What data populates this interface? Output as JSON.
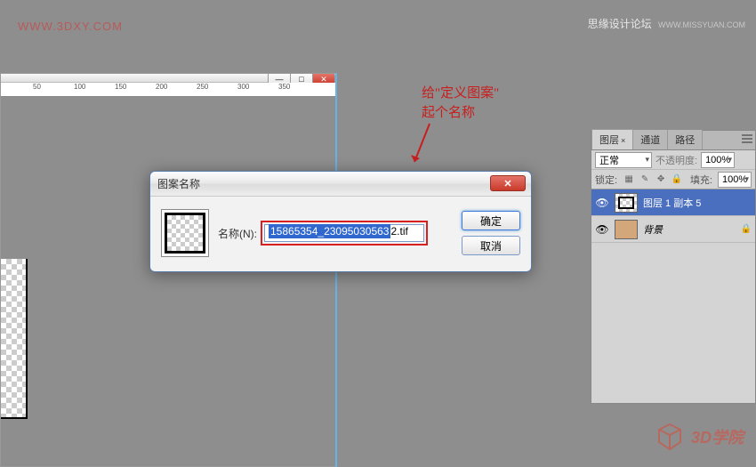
{
  "watermarks": {
    "left": "WWW.3DXY.COM",
    "right_main": "思缘设计论坛",
    "right_sub": "WWW.MISSYUAN.COM"
  },
  "annotation": {
    "line1": "给\"定义图案\"",
    "line2": "起个名称"
  },
  "dialog": {
    "title": "图案名称",
    "name_label": "名称(N):",
    "input_selected": "15865354_23095030563",
    "input_rest": "2.tif",
    "ok": "确定",
    "cancel": "取消"
  },
  "layers_panel": {
    "tabs": {
      "layers": "图层",
      "channels": "通道",
      "paths": "路径"
    },
    "blend_mode": "正常",
    "opacity_label": "不透明度:",
    "opacity_value": "100%",
    "lock_label": "锁定:",
    "fill_label": "填充:",
    "fill_value": "100%",
    "layer1": "图层 1 副本 5",
    "background": "背景"
  },
  "ruler": {
    "marks": [
      "50",
      "100",
      "150",
      "200",
      "250",
      "300",
      "350"
    ]
  },
  "logo": {
    "text": "3D学院"
  }
}
